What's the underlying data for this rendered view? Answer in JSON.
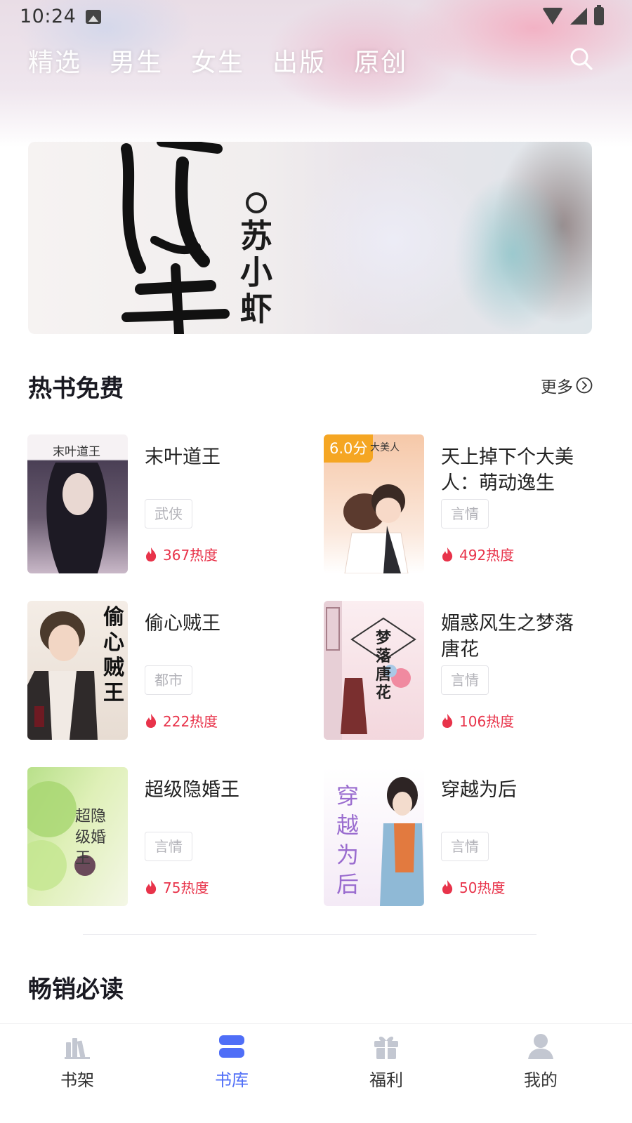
{
  "status_bar": {
    "time": "10:24"
  },
  "top_tabs": [
    {
      "label": "精选",
      "active": true
    },
    {
      "label": "男生"
    },
    {
      "label": "女生"
    },
    {
      "label": "出版"
    },
    {
      "label": "原创"
    }
  ],
  "banner": {
    "author_ring": "○",
    "author": "苏小虾"
  },
  "hot_free": {
    "title": "热书免费",
    "more_label": "更多",
    "books": [
      {
        "title": "末叶道王",
        "tag": "武侠",
        "heat": "367热度",
        "cover_text": "末叶道王",
        "cover_colors": [
          "#4a3f55",
          "#c9b8c8"
        ]
      },
      {
        "title": "天上掉下个大美人：萌动逸生",
        "tag": "言情",
        "heat": "492热度",
        "score": "6.0分",
        "cover_text": "大美人",
        "cover_colors": [
          "#f6c8a8",
          "#fbe8dc"
        ]
      },
      {
        "title": "偷心贼王",
        "tag": "都市",
        "heat": "222热度",
        "cover_text": "偷心贼王",
        "cover_colors": [
          "#d9c8b8",
          "#f4ede6"
        ]
      },
      {
        "title": "媚惑风生之梦落唐花",
        "tag": "言情",
        "heat": "106热度",
        "cover_text": "梦落唐花",
        "cover_colors": [
          "#f3d7dd",
          "#fbeef1"
        ]
      },
      {
        "title": "超级隐婚王",
        "tag": "言情",
        "heat": "75热度",
        "cover_text": "超隐级婚王",
        "cover_colors": [
          "#b8e08a",
          "#f4f7e6"
        ]
      },
      {
        "title": "穿越为后",
        "tag": "言情",
        "heat": "50热度",
        "cover_text": "穿越为后",
        "cover_colors": [
          "#ffffff",
          "#f4eaf6"
        ]
      }
    ]
  },
  "bestsellers": {
    "title": "畅销必读"
  },
  "bottom_nav": [
    {
      "label": "书架",
      "icon": "bookshelf-icon"
    },
    {
      "label": "书库",
      "icon": "library-icon",
      "active": true
    },
    {
      "label": "福利",
      "icon": "gift-icon"
    },
    {
      "label": "我的",
      "icon": "profile-icon"
    }
  ],
  "colors": {
    "accent": "#4f6ef7",
    "heat": "#e8334a",
    "score_badge": "#f5a623"
  }
}
